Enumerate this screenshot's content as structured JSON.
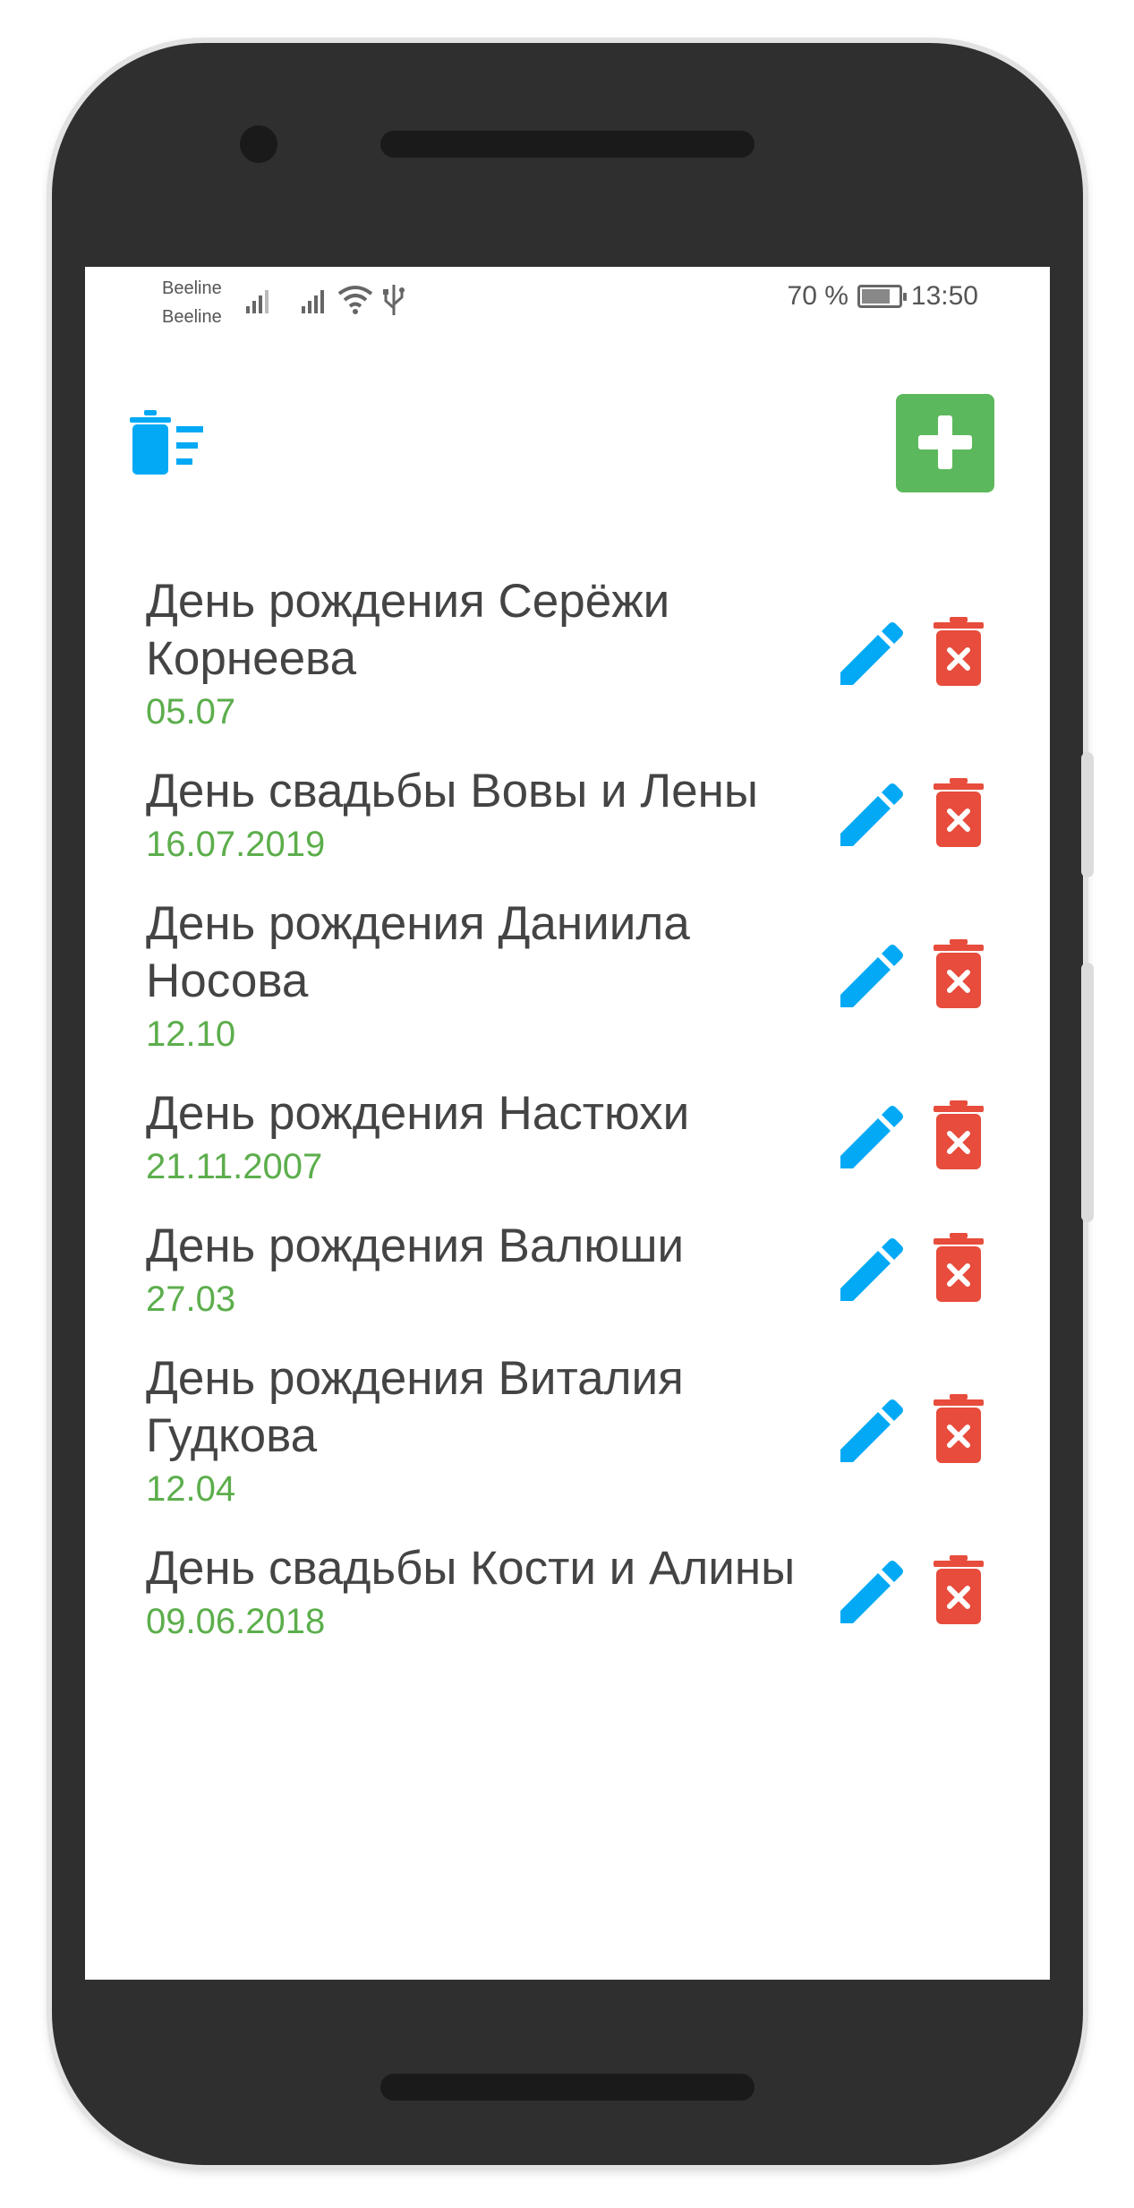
{
  "status_bar": {
    "carrier1": "Beeline",
    "carrier2": "Beeline",
    "battery": "70 %",
    "time": "13:50"
  },
  "toolbar": {
    "clear_icon": "clear-list-icon",
    "add_icon": "plus-icon",
    "add_color": "#5cb85c"
  },
  "colors": {
    "title": "#444444",
    "date": "#5cae4c",
    "edit": "#03a9f4",
    "delete": "#e74c3c"
  },
  "events": [
    {
      "title": "День рождения Серёжи Корнеева",
      "date": "05.07"
    },
    {
      "title": "День свадьбы Вовы и Лены",
      "date": "16.07.2019"
    },
    {
      "title": "День рождения Даниила Носова",
      "date": "12.10"
    },
    {
      "title": "День рождения Настюхи",
      "date": "21.11.2007"
    },
    {
      "title": "День рождения Валюши",
      "date": "27.03"
    },
    {
      "title": "День рождения Виталия Гудкова",
      "date": "12.04"
    },
    {
      "title": "День свадьбы Кости и Алины",
      "date": "09.06.2018"
    }
  ]
}
